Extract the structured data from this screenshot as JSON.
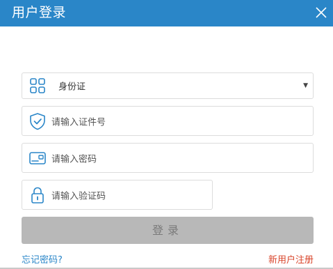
{
  "dialog": {
    "title": "用户登录",
    "accent_color": "#2a86c8"
  },
  "form": {
    "id_type": {
      "icon": "grid-icon",
      "selected": "身份证"
    },
    "id_number": {
      "icon": "shield-check-icon",
      "placeholder": "请输入证件号"
    },
    "password": {
      "icon": "card-icon",
      "placeholder": "请输入密码"
    },
    "captcha": {
      "icon": "lock-icon",
      "placeholder": "请输入验证码"
    },
    "submit_label": "登录"
  },
  "links": {
    "forgot_password": "忘记密码?",
    "register": "新用户注册",
    "register_color": "#d9452b"
  }
}
